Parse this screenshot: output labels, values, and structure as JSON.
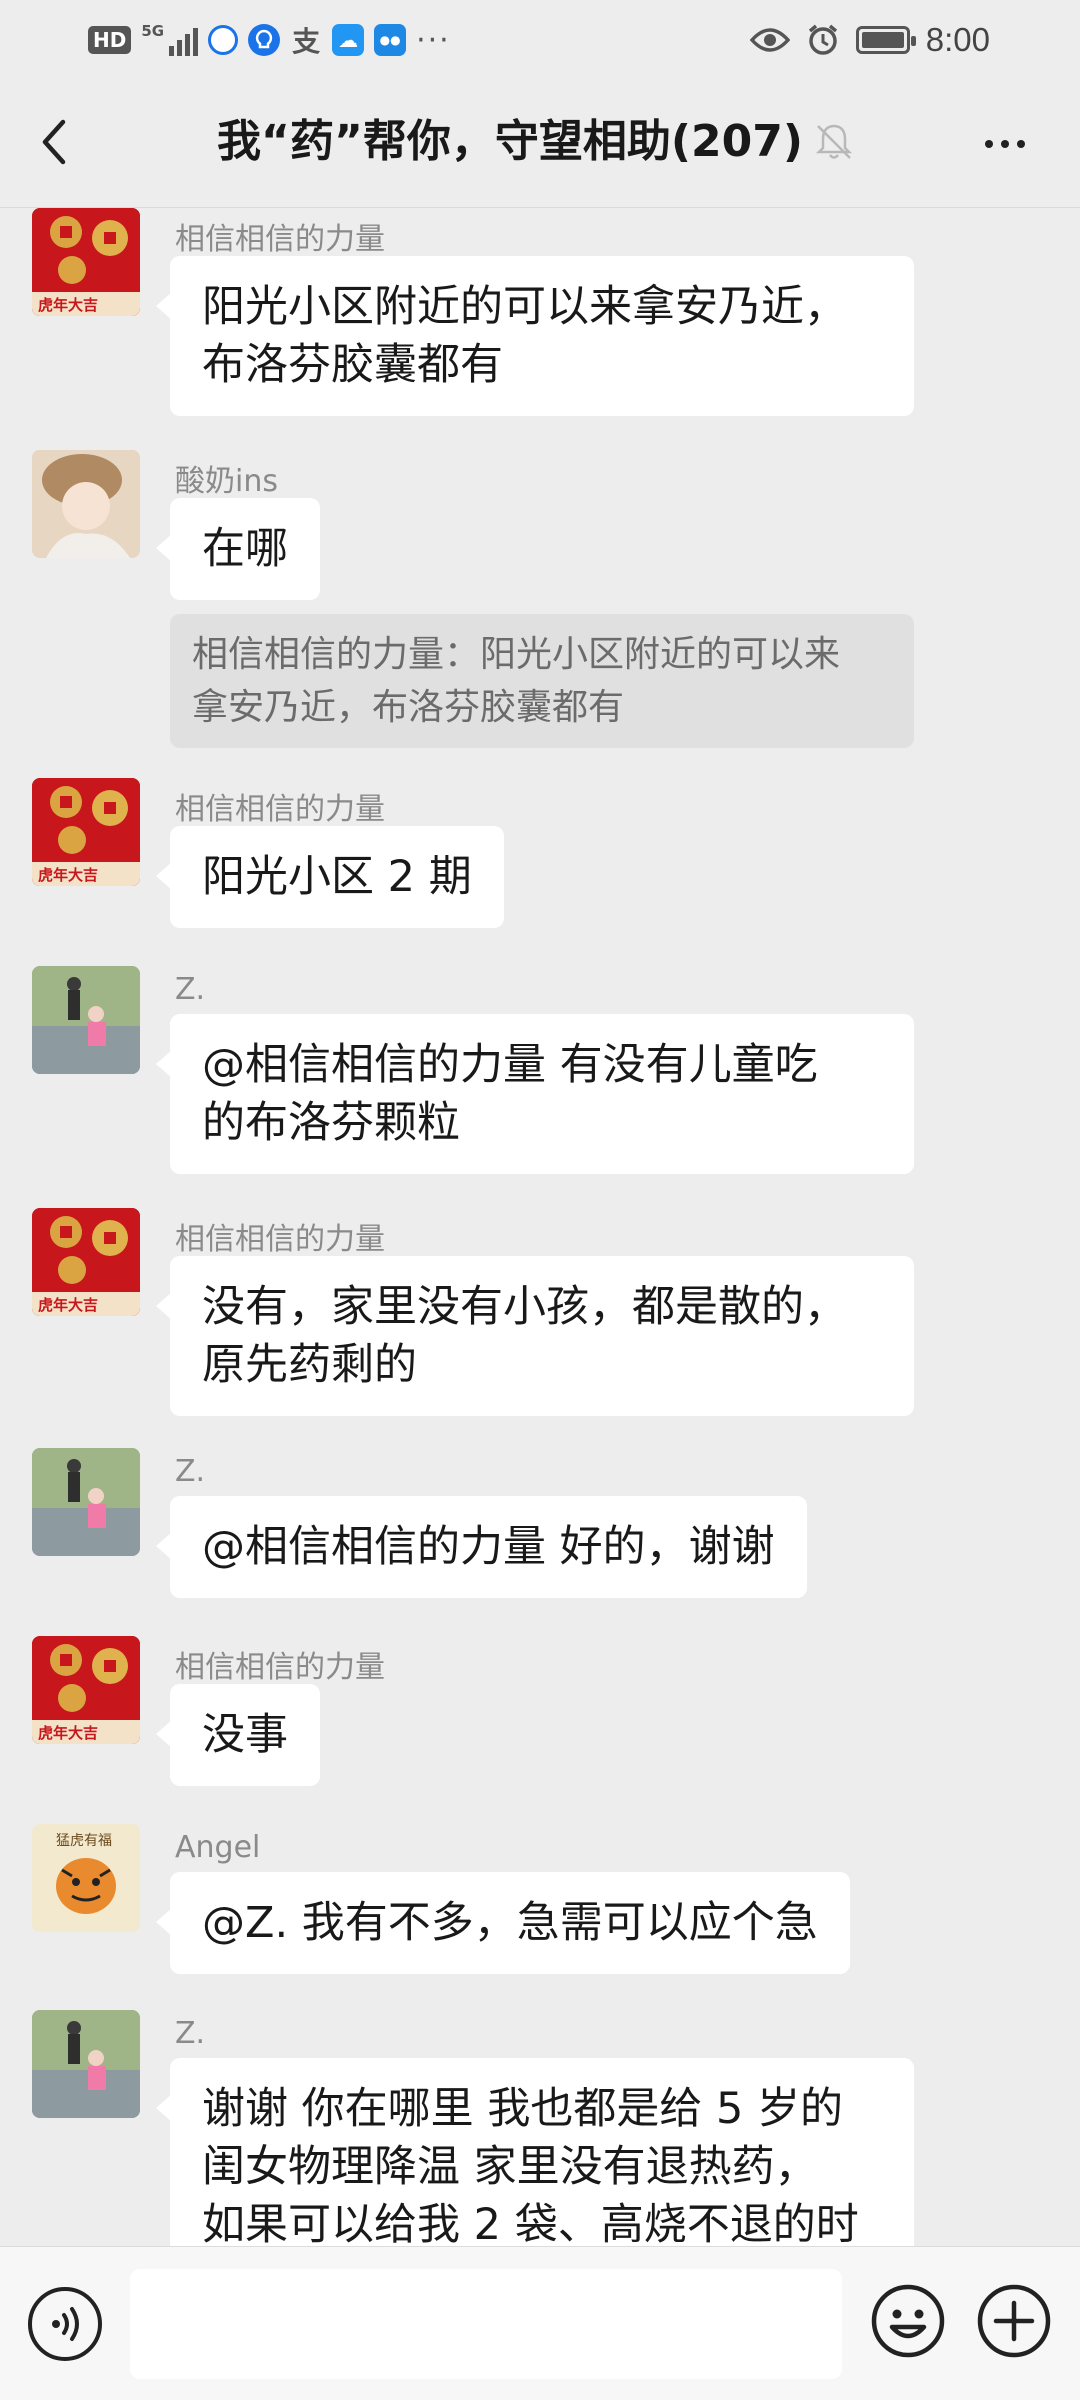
{
  "status_bar": {
    "hd": "HD",
    "network": "5G",
    "time": "8:00",
    "icons": [
      "hd-icon",
      "signal-icon",
      "chat-app-icon",
      "bulb-app-icon",
      "alipay-icon",
      "weather-app-icon",
      "app-icon",
      "more-dots-icon",
      "eye-icon",
      "alarm-icon",
      "battery-icon"
    ]
  },
  "header": {
    "title": "我“药”帮你，守望相助(207)",
    "muted": true
  },
  "messages": [
    {
      "sender": "相信相信的力量",
      "text_lines": [
        "阳光小区附近的可以来拿安乃近，",
        "布洛芬胶囊都有"
      ]
    },
    {
      "sender": "酸奶ins",
      "text_lines": [
        "在哪"
      ],
      "quote_lines": [
        "相信相信的力量：阳光小区附近的可以来",
        "拿安乃近，布洛芬胶囊都有"
      ]
    },
    {
      "sender": "相信相信的力量",
      "text_lines": [
        "阳光小区 2 期"
      ]
    },
    {
      "sender": "Z.",
      "text_lines": [
        "@相信相信的力量   有没有儿童吃",
        "的布洛芬颗粒"
      ]
    },
    {
      "sender": "相信相信的力量",
      "text_lines": [
        "没有，家里没有小孩，都是散的，",
        "原先药剩的"
      ]
    },
    {
      "sender": "Z.",
      "text_lines": [
        "@相信相信的力量  好的，谢谢"
      ]
    },
    {
      "sender": "相信相信的力量",
      "text_lines": [
        "没事"
      ]
    },
    {
      "sender": "Angel",
      "text_lines": [
        "@Z.  我有不多，急需可以应个急"
      ]
    },
    {
      "sender": "Z.",
      "text_lines": [
        "谢谢 你在哪里  我也都是给 5 岁的",
        "闺女物理降温  家里没有退热药，",
        "如果可以给我 2 袋、高烧不退的时"
      ]
    }
  ],
  "avatar_text": {
    "tiger_caption": "虎年大吉",
    "angel_caption": "猛虎有福"
  },
  "colors": {
    "background": "#ededed",
    "bubble": "#ffffff",
    "quote": "#e0e0e0",
    "sender": "#8a8a8a"
  }
}
